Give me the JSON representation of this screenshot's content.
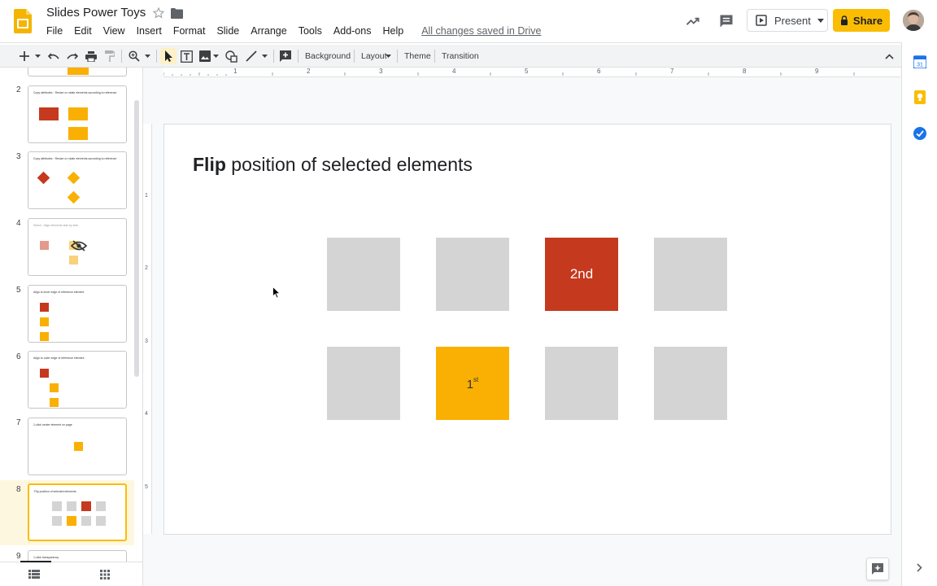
{
  "app": {
    "title": "Slides Power Toys"
  },
  "menu": [
    "File",
    "Edit",
    "View",
    "Insert",
    "Format",
    "Slide",
    "Arrange",
    "Tools",
    "Add-ons",
    "Help"
  ],
  "saved_status": "All changes saved in Drive",
  "header": {
    "present_label": "Present",
    "share_label": "Share"
  },
  "toolbar": {
    "background": "Background",
    "layout": "Layout",
    "theme": "Theme",
    "transition": "Transition"
  },
  "ruler": {
    "h_ticks": [
      "1",
      "2",
      "3",
      "4",
      "5",
      "6",
      "7",
      "8",
      "9"
    ],
    "v_ticks": [
      "1",
      "2",
      "3",
      "4",
      "5"
    ]
  },
  "filmstrip": [
    {
      "num": "2",
      "title": "Copy attributes · Resize or rotate elements according to reference"
    },
    {
      "num": "3",
      "title": "Copy attributes · Resize or rotate elements according to reference"
    },
    {
      "num": "4",
      "title": "Select · Align elements side by side"
    },
    {
      "num": "5",
      "title": "Align to inner edge of reference element"
    },
    {
      "num": "6",
      "title": "Align to outer edge of reference element"
    },
    {
      "num": "7",
      "title": "1-click center element on page"
    },
    {
      "num": "8",
      "title": "Flip position of selected elements"
    },
    {
      "num": "9",
      "title": "1-click transparency"
    }
  ],
  "slide": {
    "title_bold": "Flip",
    "title_rest": " position of selected elements",
    "box_2nd": "2nd",
    "box_1st_base": "1",
    "box_1st_sup": "st"
  },
  "colors": {
    "accent": "#fbbc04",
    "red": "#c5391e",
    "yellow": "#f9b002",
    "gray": "#d4d4d4"
  }
}
